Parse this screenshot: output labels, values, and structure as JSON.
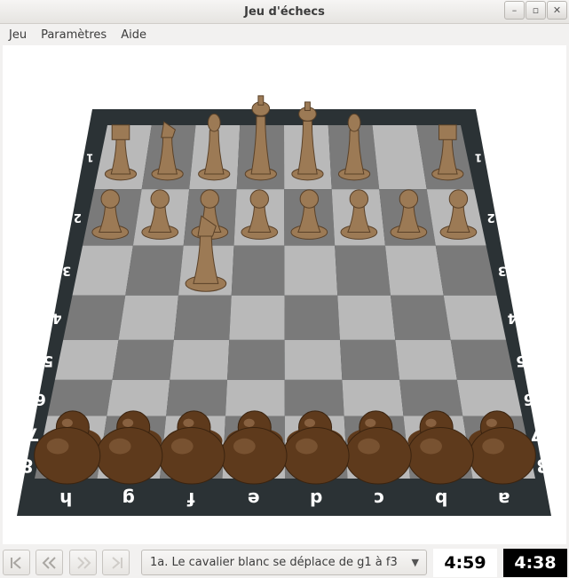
{
  "window": {
    "title": "Jeu d'échecs",
    "minimize": "–",
    "maximize": "▫",
    "close": "✕"
  },
  "menu": {
    "items": [
      "Jeu",
      "Paramètres",
      "Aide"
    ]
  },
  "board": {
    "files": [
      "h",
      "g",
      "f",
      "e",
      "d",
      "c",
      "b",
      "a"
    ],
    "ranks": [
      "1",
      "2",
      "3",
      "4",
      "5",
      "6",
      "7",
      "8"
    ],
    "colors": {
      "light": "#b9b9b9",
      "dark": "#7a7a7a",
      "frame": "#2b3235",
      "white_piece": "#9c7a55",
      "black_piece": "#5e3a1c"
    },
    "pieces": [
      {
        "type": "R",
        "side": "white",
        "file": "a",
        "rank": 1
      },
      {
        "type": "B",
        "side": "white",
        "file": "c",
        "rank": 1
      },
      {
        "type": "Q",
        "side": "white",
        "file": "d",
        "rank": 1
      },
      {
        "type": "K",
        "side": "white",
        "file": "e",
        "rank": 1
      },
      {
        "type": "B",
        "side": "white",
        "file": "f",
        "rank": 1
      },
      {
        "type": "N",
        "side": "white",
        "file": "g",
        "rank": 1
      },
      {
        "type": "R",
        "side": "white",
        "file": "h",
        "rank": 1
      },
      {
        "type": "P",
        "side": "white",
        "file": "a",
        "rank": 2
      },
      {
        "type": "P",
        "side": "white",
        "file": "b",
        "rank": 2
      },
      {
        "type": "P",
        "side": "white",
        "file": "c",
        "rank": 2
      },
      {
        "type": "P",
        "side": "white",
        "file": "d",
        "rank": 2
      },
      {
        "type": "P",
        "side": "white",
        "file": "e",
        "rank": 2
      },
      {
        "type": "P",
        "side": "white",
        "file": "f",
        "rank": 2
      },
      {
        "type": "P",
        "side": "white",
        "file": "g",
        "rank": 2
      },
      {
        "type": "P",
        "side": "white",
        "file": "h",
        "rank": 2
      },
      {
        "type": "N",
        "side": "white",
        "file": "f",
        "rank": 3
      },
      {
        "type": "P",
        "side": "black",
        "file": "a",
        "rank": 7
      },
      {
        "type": "P",
        "side": "black",
        "file": "b",
        "rank": 7
      },
      {
        "type": "P",
        "side": "black",
        "file": "c",
        "rank": 7
      },
      {
        "type": "P",
        "side": "black",
        "file": "d",
        "rank": 7
      },
      {
        "type": "P",
        "side": "black",
        "file": "e",
        "rank": 7
      },
      {
        "type": "P",
        "side": "black",
        "file": "f",
        "rank": 7
      },
      {
        "type": "P",
        "side": "black",
        "file": "g",
        "rank": 7
      },
      {
        "type": "P",
        "side": "black",
        "file": "h",
        "rank": 7
      },
      {
        "type": "R",
        "side": "black",
        "file": "a",
        "rank": 8
      },
      {
        "type": "N",
        "side": "black",
        "file": "b",
        "rank": 8
      },
      {
        "type": "B",
        "side": "black",
        "file": "c",
        "rank": 8
      },
      {
        "type": "Q",
        "side": "black",
        "file": "d",
        "rank": 8
      },
      {
        "type": "K",
        "side": "black",
        "file": "e",
        "rank": 8
      },
      {
        "type": "B",
        "side": "black",
        "file": "f",
        "rank": 8
      },
      {
        "type": "N",
        "side": "black",
        "file": "g",
        "rank": 8
      },
      {
        "type": "R",
        "side": "black",
        "file": "h",
        "rank": 8
      }
    ]
  },
  "controls": {
    "first_icon": "first-move-icon",
    "prev_icon": "previous-move-icon",
    "next_icon": "next-move-icon",
    "last_icon": "last-move-icon",
    "history_text": "1a. Le cavalier blanc se déplace de g1 à f3",
    "white_clock": "4:59",
    "black_clock": "4:38"
  }
}
